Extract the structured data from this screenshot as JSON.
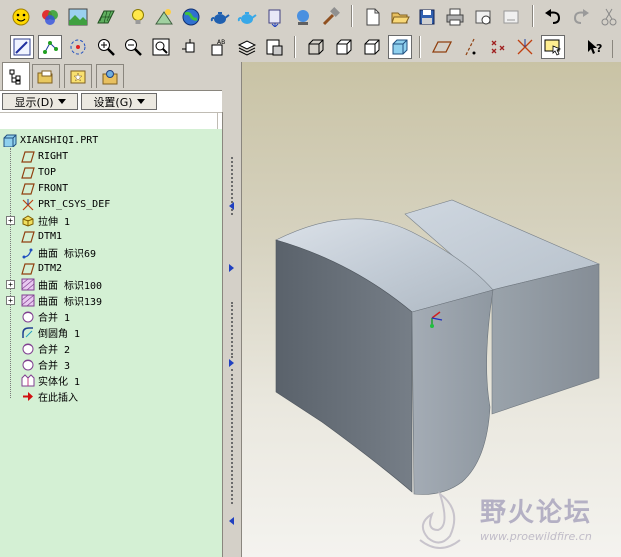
{
  "toolbar_top": {
    "icons": [
      "smiley-icon",
      "color-wheel-icon",
      "landscape-icon",
      "grid-terrain-icon",
      "lightbulb-icon",
      "scene-icon",
      "globe-icon",
      "teapot-icon",
      "teapot-blue-icon",
      "cube-arrow-icon",
      "user-globe-icon",
      "hammer-icon",
      "new-file-icon",
      "open-folder-icon",
      "save-icon",
      "print-icon",
      "lock-window-icon",
      "erase-window-icon",
      "undo-icon",
      "redo-icon",
      "scissors-icon"
    ]
  },
  "toolbar_bottom": {
    "icons": [
      "sketch-view-icon",
      "datum-points-icon",
      "spin-center-icon",
      "zoom-in-icon",
      "zoom-out-icon",
      "zoom-fit-icon",
      "reorient-icon",
      "named-views-icon",
      "layers-icon",
      "view-manager-icon",
      "wireframe-icon",
      "hidden-line-icon",
      "no-hidden-icon",
      "shading-icon",
      "datum-planes-icon",
      "datum-axes-icon",
      "datum-points-display-icon",
      "csys-display-icon",
      "select-window-icon",
      "context-help-icon"
    ]
  },
  "tabs": [
    "model-tree-tab-icon",
    "folder-browser-tab-icon",
    "favorites-tab-icon",
    "connections-tab-icon"
  ],
  "menubar": {
    "show_label": "显示(D)",
    "settings_label": "设置(G)"
  },
  "tree": {
    "root": "XIANSHIQI.PRT",
    "items": [
      {
        "label": "RIGHT",
        "icon": "datum-plane-icon",
        "expandable": false
      },
      {
        "label": "TOP",
        "icon": "datum-plane-icon",
        "expandable": false
      },
      {
        "label": "FRONT",
        "icon": "datum-plane-icon",
        "expandable": false
      },
      {
        "label": "PRT_CSYS_DEF",
        "icon": "csys-icon",
        "expandable": false
      },
      {
        "label": "拉伸 1",
        "icon": "extrude-icon",
        "expandable": true
      },
      {
        "label": "DTM1",
        "icon": "datum-plane-icon",
        "expandable": false
      },
      {
        "label": "曲面 标识69",
        "icon": "surface-curve-icon",
        "expandable": false
      },
      {
        "label": "DTM2",
        "icon": "datum-plane-icon",
        "expandable": false
      },
      {
        "label": "曲面 标识100",
        "icon": "surface-icon",
        "expandable": true
      },
      {
        "label": "曲面 标识139",
        "icon": "surface-icon",
        "expandable": true
      },
      {
        "label": "合并 1",
        "icon": "merge-icon",
        "expandable": false
      },
      {
        "label": "倒圆角 1",
        "icon": "round-icon",
        "expandable": false
      },
      {
        "label": "合并 2",
        "icon": "merge-icon",
        "expandable": false
      },
      {
        "label": "合并 3",
        "icon": "merge-icon",
        "expandable": false
      },
      {
        "label": "实体化 1",
        "icon": "solidify-icon",
        "expandable": false
      },
      {
        "label": "在此插入",
        "icon": "insert-here-arrow-icon",
        "expandable": false
      }
    ]
  },
  "watermark": {
    "title": "野火论坛",
    "url": "www.proewildfire.cn"
  },
  "colors": {
    "tree_bg": "#d4f0d4",
    "model_light": "#c4cdd6",
    "model_dark": "#6f7780"
  }
}
